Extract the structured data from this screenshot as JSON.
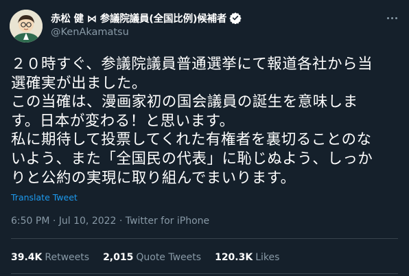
{
  "tweet": {
    "display_name": "赤松 健 ⋈ 参議院議員(全国比例)候補者",
    "handle": "@KenAkamatsu",
    "body_lines": [
      "２０時すぐ、参議院議員普通選挙にて報道各社から当",
      "選確実が出ました。",
      "この当確は、漫画家初の国会議員の誕生を意味しま",
      "す。日本が変わる！と思います。",
      "私に期待して投票してくれた有権者を裏切ることのな",
      "いよう、また「全国民の代表」に恥じぬよう、しっか",
      "りと公約の実現に取り組んでまいります。"
    ],
    "translate_label": "Translate Tweet",
    "timestamp": "6:50 PM · Jul 10, 2022 · Twitter for iPhone",
    "stats": {
      "retweets": {
        "count": "39.4K",
        "label": "Retweets"
      },
      "quotes": {
        "count": "2,015",
        "label": "Quote Tweets"
      },
      "likes": {
        "count": "120.3K",
        "label": "Likes"
      }
    }
  },
  "icons": {
    "avatar": "avatar",
    "verified": "verified-badge-icon",
    "more": "more-options-icon"
  },
  "colors": {
    "background": "#15202b",
    "text": "#ffffff",
    "muted": "#8899a6",
    "link": "#1d9bf0",
    "divider": "#38444d"
  }
}
